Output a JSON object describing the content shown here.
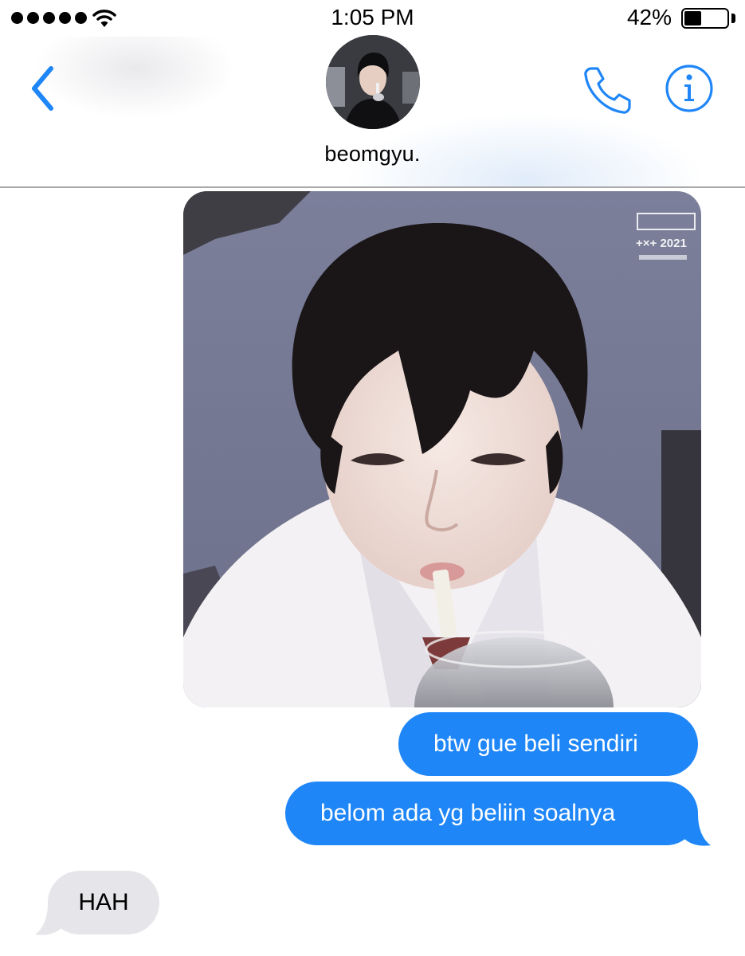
{
  "status_bar": {
    "time": "1:05 PM",
    "battery_percent": "42%",
    "battery_level": 0.42,
    "signal_icon": "signal-dots-icon",
    "wifi_icon": "wifi-icon",
    "battery_icon": "battery-icon"
  },
  "header": {
    "contact_name": "beomgyu.",
    "back_icon": "chevron-left-icon",
    "call_icon": "phone-icon",
    "info_icon": "info-icon"
  },
  "messages": [
    {
      "type": "image",
      "direction": "outgoing"
    },
    {
      "type": "text",
      "direction": "outgoing",
      "text": "btw gue beli sendiri"
    },
    {
      "type": "text",
      "direction": "outgoing",
      "text": "belom ada yg beliin soalnya"
    },
    {
      "type": "text",
      "direction": "incoming",
      "text": "HAH"
    }
  ],
  "photo_overlay_text": "+×+ 2021",
  "colors": {
    "accent": "#1f86f7",
    "incoming_bubble": "#e6e6ea",
    "divider": "#a9a9a9"
  }
}
